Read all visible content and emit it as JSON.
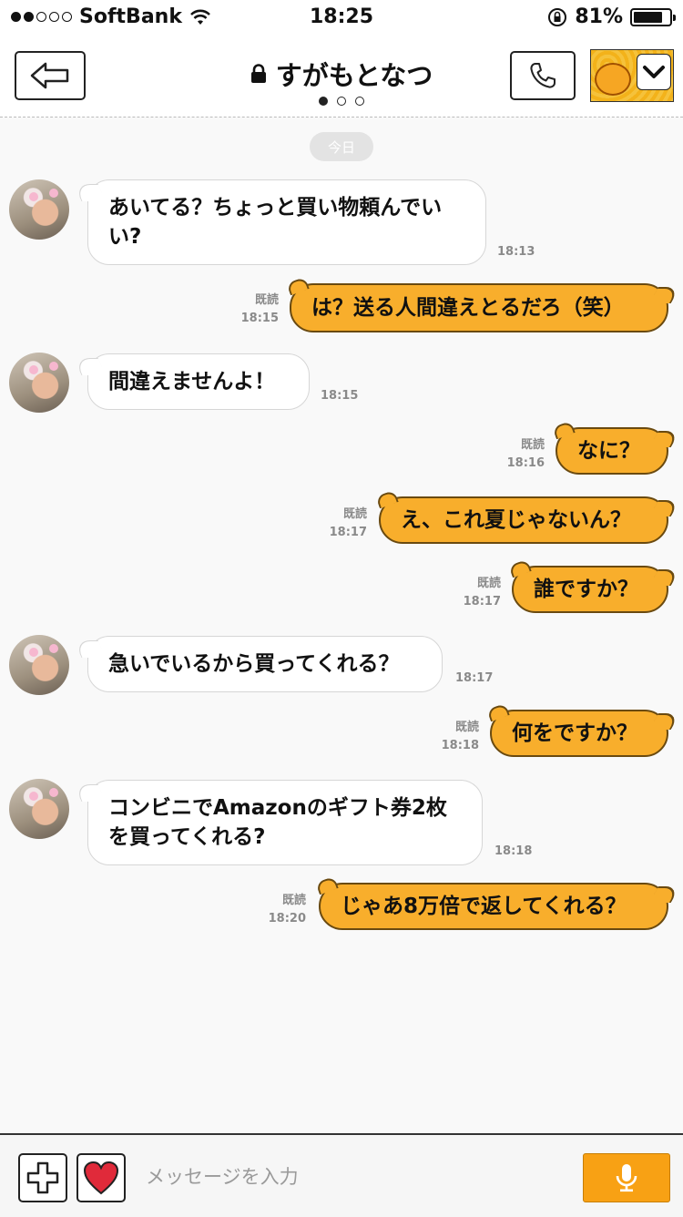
{
  "status_bar": {
    "carrier": "SoftBank",
    "time": "18:25",
    "battery": "81%",
    "battery_level": 0.81,
    "signal_bars": 2
  },
  "header": {
    "title": "すがもとなつ",
    "page_dots": 3,
    "active_page": 0
  },
  "chat": {
    "date_label": "今日",
    "messages": [
      {
        "side": "in",
        "text": "あいてる？ちょっと買い物頼んでいい?",
        "time": "18:13"
      },
      {
        "side": "out",
        "text": "は？送る人間違えとるだろ（笑）",
        "read": "既読",
        "time": "18:15"
      },
      {
        "side": "in",
        "text": "間違えませんよ！",
        "time": "18:15"
      },
      {
        "side": "out",
        "text": "なに？",
        "read": "既読",
        "time": "18:16"
      },
      {
        "side": "out",
        "text": "え、これ夏じゃないん？",
        "read": "既読",
        "time": "18:17"
      },
      {
        "side": "out",
        "text": "誰ですか？",
        "read": "既読",
        "time": "18:17"
      },
      {
        "side": "in",
        "text": "急いでいるから買ってくれる？",
        "time": "18:17"
      },
      {
        "side": "out",
        "text": "何をですか？",
        "read": "既読",
        "time": "18:18"
      },
      {
        "side": "in",
        "text": "コンビニでAmazonのギフト券2枚を買ってくれる?",
        "time": "18:18"
      },
      {
        "side": "out",
        "text": "じゃあ8万倍で返してくれる？",
        "read": "既読",
        "time": "18:20"
      }
    ]
  },
  "input_bar": {
    "placeholder": "メッセージを入力"
  },
  "colors": {
    "out_bubble": "#f8ae2c",
    "mic_button": "#f8a114",
    "in_bubble": "#ffffff"
  }
}
